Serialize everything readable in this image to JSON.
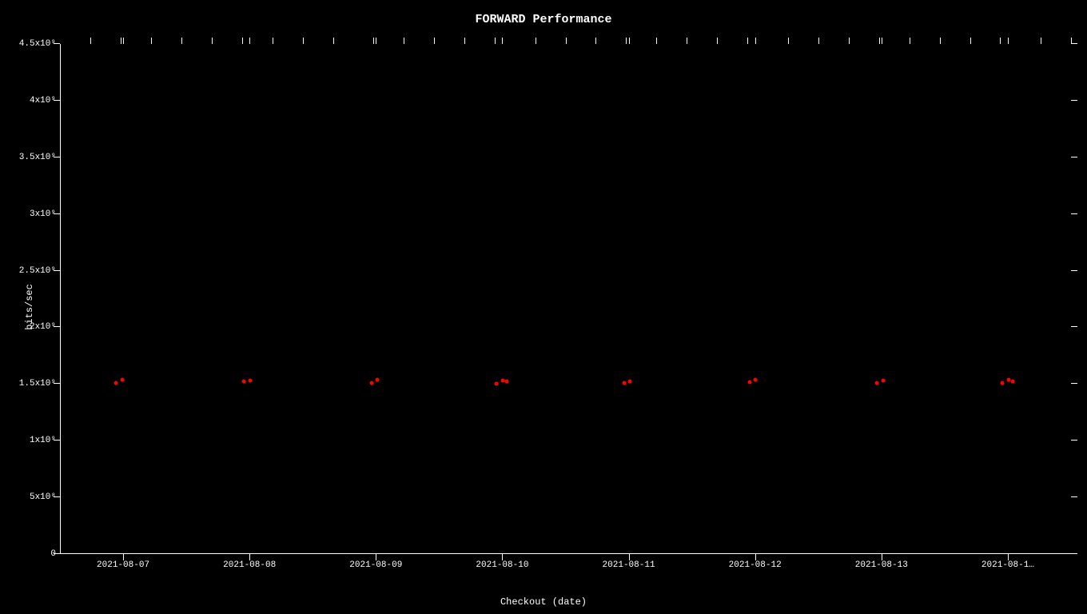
{
  "chart": {
    "title": "FORWARD Performance",
    "x_axis_label": "Checkout (date)",
    "y_axis_label": "bits/sec",
    "y_ticks": [
      {
        "label": "0",
        "pct": 0
      },
      {
        "label": "5x10⁸",
        "pct": 11.11
      },
      {
        "label": "1x10⁹",
        "pct": 22.22
      },
      {
        "label": "1.5x10⁹",
        "pct": 33.33
      },
      {
        "label": "2x10⁹",
        "pct": 44.44
      },
      {
        "label": "2.5x10⁹",
        "pct": 55.56
      },
      {
        "label": "3x10⁹",
        "pct": 66.67
      },
      {
        "label": "3.5x10⁹",
        "pct": 77.78
      },
      {
        "label": "4x10⁹",
        "pct": 88.89
      },
      {
        "label": "4.5x10⁹",
        "pct": 100
      }
    ],
    "x_ticks": [
      {
        "label": "2021-08-07",
        "pct": 6.25
      },
      {
        "label": "2021-08-08",
        "pct": 18.75
      },
      {
        "label": "2021-08-09",
        "pct": 31.25
      },
      {
        "label": "2021-08-10",
        "pct": 43.75
      },
      {
        "label": "2021-08-11",
        "pct": 56.25
      },
      {
        "label": "2021-08-12",
        "pct": 68.75
      },
      {
        "label": "2021-08-13",
        "pct": 81.25
      },
      {
        "label": "2021-08-1…",
        "pct": 93.75
      }
    ],
    "data_points": [
      {
        "x_pct": 5.5,
        "y_pct": 33.5
      },
      {
        "x_pct": 6.2,
        "y_pct": 34.2
      },
      {
        "x_pct": 18.2,
        "y_pct": 33.8
      },
      {
        "x_pct": 18.8,
        "y_pct": 34.0
      },
      {
        "x_pct": 30.8,
        "y_pct": 33.6
      },
      {
        "x_pct": 31.4,
        "y_pct": 34.1
      },
      {
        "x_pct": 43.2,
        "y_pct": 33.4
      },
      {
        "x_pct": 43.8,
        "y_pct": 34.0
      },
      {
        "x_pct": 44.2,
        "y_pct": 33.8
      },
      {
        "x_pct": 55.8,
        "y_pct": 33.6
      },
      {
        "x_pct": 56.4,
        "y_pct": 33.9
      },
      {
        "x_pct": 68.2,
        "y_pct": 33.7
      },
      {
        "x_pct": 68.8,
        "y_pct": 34.1
      },
      {
        "x_pct": 80.8,
        "y_pct": 33.5
      },
      {
        "x_pct": 81.4,
        "y_pct": 34.0
      },
      {
        "x_pct": 93.2,
        "y_pct": 33.6
      },
      {
        "x_pct": 93.8,
        "y_pct": 34.2
      },
      {
        "x_pct": 94.2,
        "y_pct": 33.8
      }
    ],
    "top_tick_pcts": [
      3,
      6,
      9,
      12,
      15,
      18,
      21,
      24,
      27,
      31,
      34,
      37,
      40,
      43,
      47,
      50,
      53,
      56,
      59,
      62,
      65,
      68,
      72,
      75,
      78,
      81,
      84,
      87,
      90,
      93,
      97,
      100
    ]
  }
}
